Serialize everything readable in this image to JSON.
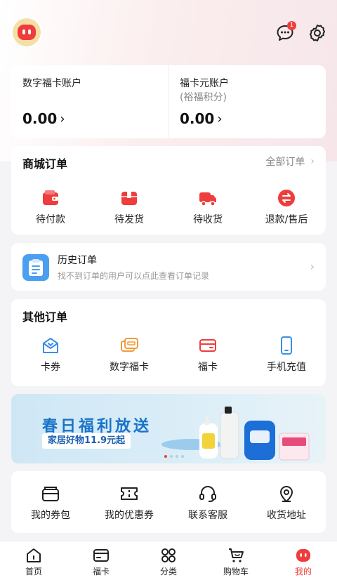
{
  "header": {
    "message_badge": "1"
  },
  "accounts": [
    {
      "label": "数字福卡账户",
      "sub": "",
      "amount": "0.00",
      "chevron": "›"
    },
    {
      "label": "福卡元账户",
      "sub": "(裕福积分)",
      "amount": "0.00",
      "chevron": "›"
    }
  ],
  "mall_orders": {
    "title": "商城订单",
    "all_label": "全部订单",
    "chevron": "›",
    "items": [
      {
        "label": "待付款",
        "icon": "wallet-icon"
      },
      {
        "label": "待发货",
        "icon": "box-icon"
      },
      {
        "label": "待收货",
        "icon": "truck-icon"
      },
      {
        "label": "退款/售后",
        "icon": "refund-icon"
      }
    ]
  },
  "history": {
    "title": "历史订单",
    "subtitle": "找不到订单的用户可以点此查看订单记录",
    "chevron": "›"
  },
  "other_orders": {
    "title": "其他订单",
    "items": [
      {
        "label": "卡券",
        "icon": "envelope-icon"
      },
      {
        "label": "数字福卡",
        "icon": "digital-card-icon"
      },
      {
        "label": "福卡",
        "icon": "card-icon"
      },
      {
        "label": "手机充值",
        "icon": "phone-icon"
      }
    ]
  },
  "banner": {
    "title": "春日福利放送",
    "subtitle": "家居好物11.9元起"
  },
  "tools": {
    "items": [
      {
        "label": "我的券包",
        "icon": "wallet-outline-icon"
      },
      {
        "label": "我的优惠券",
        "icon": "coupon-icon"
      },
      {
        "label": "联系客服",
        "icon": "headset-icon"
      },
      {
        "label": "收货地址",
        "icon": "location-icon"
      }
    ]
  },
  "tabbar": {
    "items": [
      {
        "label": "首页",
        "icon": "home-icon",
        "active": false
      },
      {
        "label": "福卡",
        "icon": "card-tab-icon",
        "active": false
      },
      {
        "label": "分类",
        "icon": "category-icon",
        "active": false
      },
      {
        "label": "购物车",
        "icon": "cart-icon",
        "active": false
      },
      {
        "label": "我的",
        "icon": "profile-icon",
        "active": true
      }
    ]
  },
  "colors": {
    "accent": "#ef3c3c",
    "blue": "#3a8ee6",
    "orange": "#f29a3a",
    "banner_blue": "#1873c9"
  }
}
